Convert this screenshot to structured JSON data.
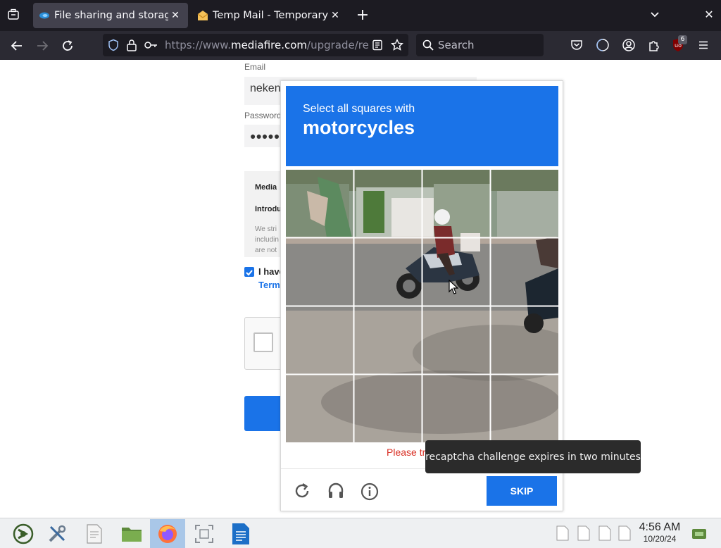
{
  "browser": {
    "tabs": [
      {
        "title": "File sharing and storage made simple",
        "active": true
      },
      {
        "title": "Temp Mail - Temporary Disposable Email",
        "active": false
      }
    ],
    "url": {
      "prefix": "https://www.",
      "domain": "mediafire.com",
      "path": "/upgrade/registration"
    },
    "search_placeholder": "Search",
    "extension_badge": "6"
  },
  "page": {
    "email_label": "Email",
    "email_value": "nekenl",
    "password_label": "Password",
    "password_value": "●●●●●",
    "notice_title": "Media",
    "notice_subtitle": "Introdu",
    "notice_lines": [
      "We stri",
      "includin",
      "are not"
    ],
    "agree_text": "I have",
    "terms_link": "Term"
  },
  "captcha": {
    "instruction": "Select all squares with",
    "target": "motorcycles",
    "error": "Please try again.",
    "skip_label": "SKIP",
    "tooltip": "recaptcha challenge expires in two minutes"
  },
  "taskbar": {
    "time": "4:56 AM",
    "date": "10/20/24"
  },
  "colors": {
    "accent": "#1a73e8",
    "error": "#d93025",
    "link": "#1a73e8"
  }
}
